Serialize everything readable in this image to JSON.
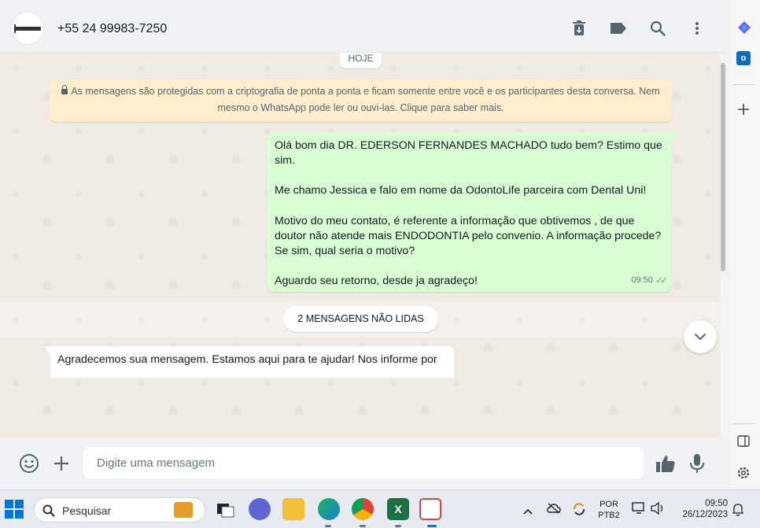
{
  "header": {
    "contact": "+55 24 99983-7250",
    "icons": [
      "delete-icon",
      "label-icon",
      "search-icon",
      "menu-icon"
    ]
  },
  "chat": {
    "date_chip": "HOJE",
    "encryption_notice": "As mensagens são protegidas com a criptografia de ponta a ponta e ficam somente entre você e os participantes desta conversa. Nem mesmo o WhatsApp pode ler ou ouvi-las. Clique para saber mais.",
    "outgoing": {
      "paragraphs": [
        "Olá bom dia DR. EDERSON FERNANDES MACHADO tudo bem? Estimo que sim.",
        "Me chamo Jessica e falo em nome da OdontoLife parceira com Dental Uni!",
        "Motivo do meu contato, é referente a informação que obtivemos , de que doutor não atende mais ENDODONTIA pelo convenio. A informação procede? Se sim, qual seria o motivo?",
        "Aguardo seu retorno, desde ja agradeço!"
      ],
      "time": "09:50",
      "status": "sent"
    },
    "unread_banner": "2 MENSAGENS NÃO LIDAS",
    "incoming": {
      "text": "Agradecemos sua mensagem. Estamos aqui para te ajudar! Nos informe por"
    }
  },
  "composer": {
    "placeholder": "Digite uma mensagem",
    "icons": [
      "emoji-icon",
      "attach-icon",
      "like-icon",
      "mic-icon"
    ]
  },
  "taskbar": {
    "search_placeholder": "Pesquisar",
    "language_line1": "POR",
    "language_line2": "PTB2",
    "time": "09:50",
    "date": "26/12/2023"
  }
}
